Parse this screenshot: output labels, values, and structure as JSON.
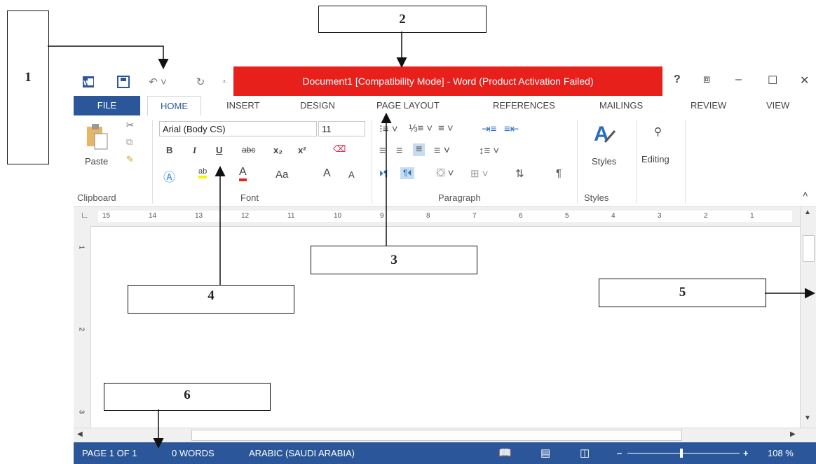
{
  "window": {
    "title": "Document1 [Compatibility Mode] -  Word (Product Activation Failed)",
    "controls": {
      "help": "?",
      "restore_ribbon": "⧈",
      "minimize": "–",
      "maximize": "☐",
      "close": "✕"
    }
  },
  "quick_access": {
    "word_icon": "word-logo-icon",
    "save": "save-icon",
    "undo": "undo-icon",
    "redo": "redo-icon",
    "customize": "customize-icon"
  },
  "tabs": [
    "FILE",
    "HOME",
    "INSERT",
    "DESIGN",
    "PAGE LAYOUT",
    "REFERENCES",
    "MAILINGS",
    "REVIEW",
    "VIEW"
  ],
  "ribbon": {
    "clipboard": {
      "paste": "Paste",
      "label": "Clipboard"
    },
    "font": {
      "family": "Arial (Body CS)",
      "size": "11",
      "label": "Font",
      "case": "Aa",
      "strike": "abc",
      "sub": "x₂",
      "sup": "x²",
      "bold": "B",
      "italic": "I",
      "underline": "U",
      "grow": "A",
      "shrink": "A"
    },
    "paragraph": {
      "label": "Paragraph"
    },
    "styles": {
      "label": "Styles",
      "button": "Styles"
    },
    "editing": {
      "button": "Editing"
    }
  },
  "ruler": {
    "numbers": [
      "15",
      "14",
      "13",
      "12",
      "11",
      "10",
      "9",
      "8",
      "7",
      "6",
      "5",
      "4",
      "3",
      "2",
      "1"
    ]
  },
  "vruler": {
    "numbers": [
      "1",
      "2",
      "3"
    ]
  },
  "status": {
    "page": "PAGE 1 OF 1",
    "words": "0 WORDS",
    "language": "ARABIC (SAUDI ARABIA)",
    "zoom": "108 %",
    "minus": "–",
    "plus": "+"
  },
  "callouts": {
    "c1": "1",
    "c2": "2",
    "c3": "3",
    "c4": "4",
    "c5": "5",
    "c6": "6"
  }
}
